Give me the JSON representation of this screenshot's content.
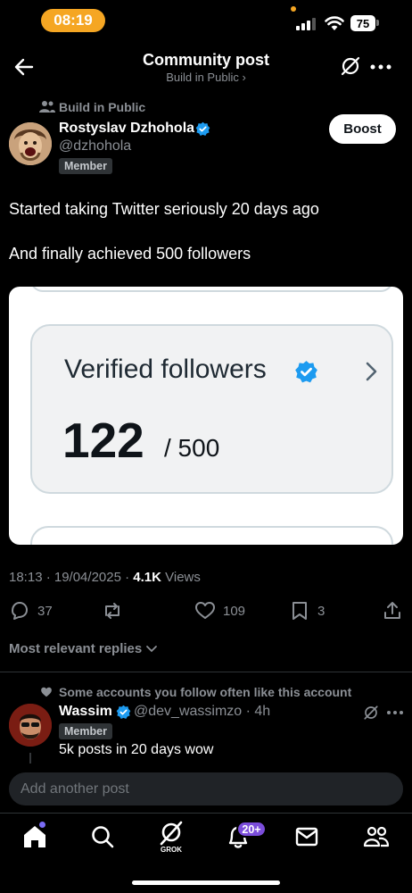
{
  "status_bar": {
    "time": "08:19",
    "battery": "75"
  },
  "header": {
    "title": "Community post",
    "subtitle": "Build in Public ›"
  },
  "post": {
    "community": "Build in Public",
    "author_name": "Rostyslav Dzhohola",
    "author_handle": "@dzhohola",
    "member_badge": "Member",
    "boost_label": "Boost",
    "text_line1": "Started taking Twitter seriously 20 days ago",
    "text_line2": "And finally achieved 500 followers",
    "image": {
      "title": "Verified followers",
      "value": "122",
      "total": "/ 500"
    },
    "timestamp": "18:13 · 19/04/2025 · ",
    "views_count": "4.1K",
    "views_label": " Views",
    "replies": "37",
    "likes": "109",
    "bookmarks": "3"
  },
  "replies_sort_label": "Most relevant replies",
  "reply": {
    "context": "Some accounts you follow often like this account",
    "name": "Wassim",
    "handle_time": "@dev_wassimzo · 4h",
    "member_badge": "Member",
    "text": "5k posts in 20 days wow"
  },
  "compose_placeholder": "Add another post",
  "nav": {
    "grok_label": "GROK",
    "notif_count": "20+"
  },
  "colors": {
    "verified": "#1d9bf0",
    "accent": "#7b4ddb",
    "background": "#000000"
  }
}
